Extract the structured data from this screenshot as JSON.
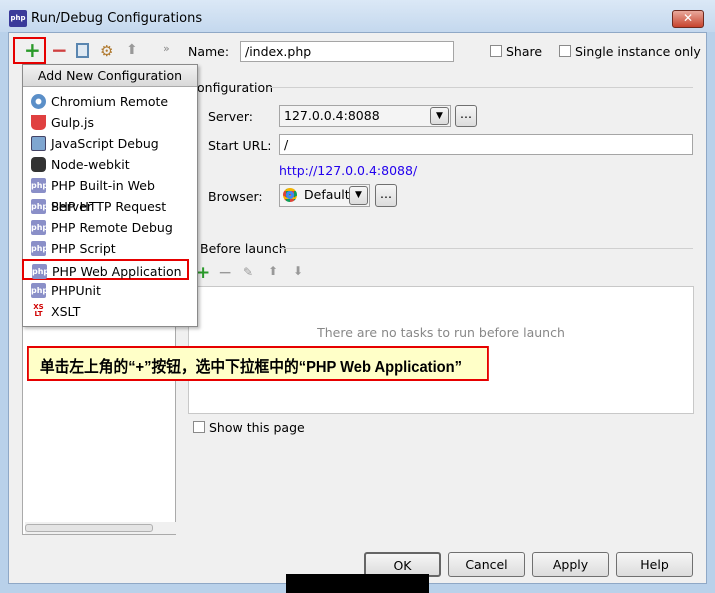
{
  "window": {
    "title": "Run/Debug Configurations",
    "app_icon": "phpstorm-icon",
    "close_label": "✕"
  },
  "toolbar": {
    "add": "+",
    "remove": "−",
    "more": "»"
  },
  "name_field": {
    "label": "Name:",
    "value": "/index.php"
  },
  "share": {
    "label": "Share",
    "checked": false
  },
  "single_instance": {
    "label": "Single instance only",
    "checked": false
  },
  "configuration": {
    "section_label": "onfiguration",
    "server_label": "Server:",
    "server_value": "127.0.0.4:8088",
    "start_url_label": "Start URL:",
    "start_url_value": "/",
    "resolved_url": "http://127.0.0.4:8088/",
    "browser_label": "Browser:",
    "browser_value": "Default",
    "ellipsis": "..."
  },
  "before_launch": {
    "label": "Before launch",
    "empty_text": "There are no tasks to run before launch",
    "show_page_label": "Show this page"
  },
  "popup": {
    "header": "Add New Configuration",
    "items": [
      {
        "label": "Chromium Remote",
        "icon": "chromium-icon"
      },
      {
        "label": "Gulp.js",
        "icon": "gulp-icon"
      },
      {
        "label": "JavaScript Debug",
        "icon": "javascript-debug-icon"
      },
      {
        "label": "Node-webkit",
        "icon": "node-webkit-icon"
      },
      {
        "label": "PHP Built-in Web Server",
        "icon": "php-server-icon"
      },
      {
        "label": "PHP HTTP Request",
        "icon": "php-http-icon"
      },
      {
        "label": "PHP Remote Debug",
        "icon": "php-remote-debug-icon"
      },
      {
        "label": "PHP Script",
        "icon": "php-script-icon"
      },
      {
        "label": "PHP Web Application",
        "icon": "php-web-app-icon",
        "highlighted": true
      },
      {
        "label": "PHPUnit",
        "icon": "phpunit-icon"
      },
      {
        "label": "XSLT",
        "icon": "xslt-icon"
      }
    ]
  },
  "annotation": "单击左上角的“+”按钮，选中下拉框中的“PHP Web Application”",
  "buttons": {
    "ok": "OK",
    "cancel": "Cancel",
    "apply": "Apply",
    "help": "Help"
  },
  "colors": {
    "highlight_box": "#e60000",
    "annotation_bg": "#ffffc8",
    "link": "#2200ee",
    "add_green": "#2a9a2a"
  }
}
